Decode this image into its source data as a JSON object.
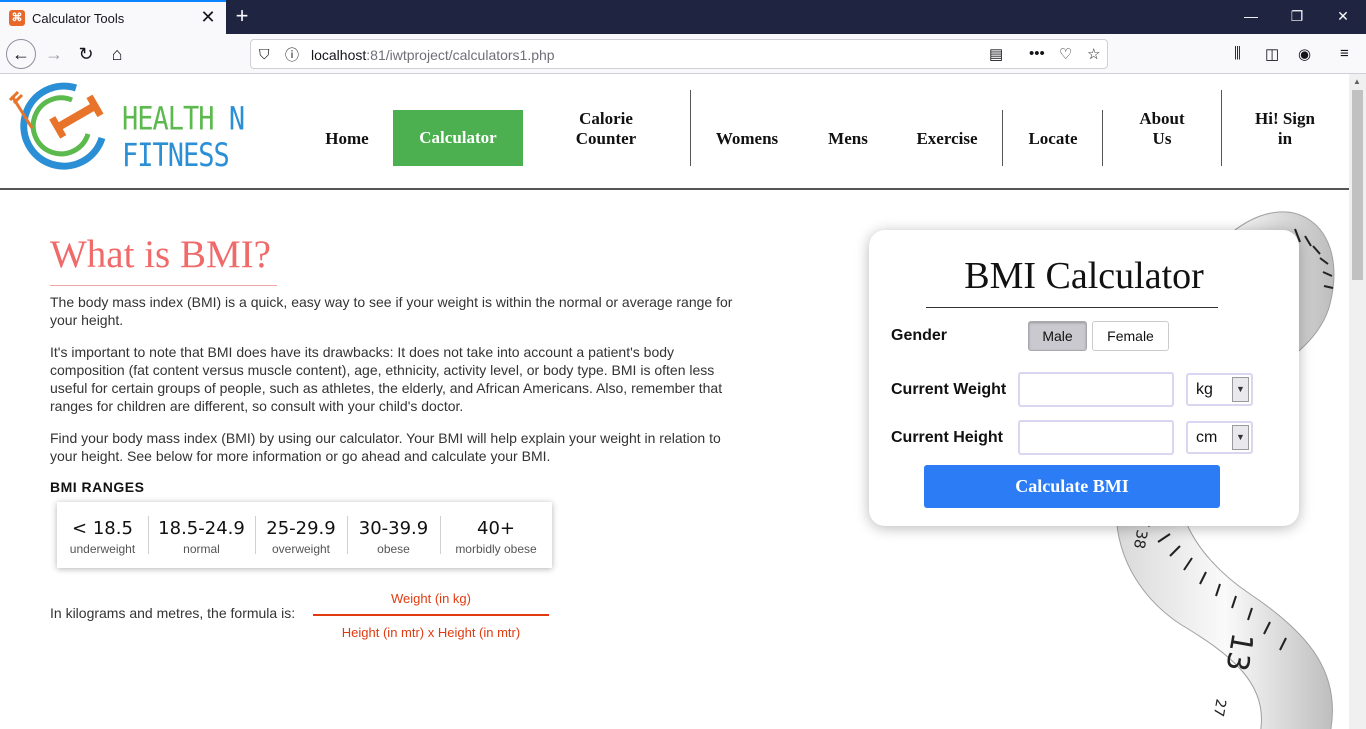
{
  "browser": {
    "tab_title": "Calculator Tools",
    "url_host": "localhost",
    "url_port": ":81",
    "url_path": "/iwtproject/calculators1.php"
  },
  "site": {
    "logo": {
      "word1": "HEALTH",
      "word2": "N",
      "word3": "FITNESS",
      "green": "#5bb94d",
      "blue": "#2b8fd6"
    },
    "menu": {
      "home": "Home",
      "calculator": "Calculator",
      "calorie_1": "Calorie",
      "calorie_2": "Counter",
      "womens": "Womens",
      "mens": "Mens",
      "exercise": "Exercise",
      "locate": "Locate",
      "about_1": "About",
      "about_2": "Us",
      "signin_1": "Hi! Sign",
      "signin_2": "in"
    },
    "active_color": "#4cb050"
  },
  "content": {
    "title": "What is BMI?",
    "p1": "The body mass index (BMI) is a quick, easy way to see if your weight is within the normal or average range for your height.",
    "p2": "It's important to note that BMI does have its drawbacks: It does not take into account a patient's body composition (fat content versus muscle content), age, ethnicity, activity level, or body type. BMI is often less useful for certain groups of people, such as athletes, the elderly, and African Americans. Also, remember that ranges for children are different, so consult with your child's doctor.",
    "p3": "Find your body mass index (BMI) by using our calculator. Your BMI will help explain your weight in relation to your height. See below for more information or go ahead and calculate your BMI.",
    "ranges_heading": "BMI RANGES",
    "ranges": [
      {
        "value": "< 18.5",
        "label": "underweight"
      },
      {
        "value": "18.5-24.9",
        "label": "normal"
      },
      {
        "value": "25-29.9",
        "label": "overweight"
      },
      {
        "value": "30-39.9",
        "label": "obese"
      },
      {
        "value": "40+",
        "label": "morbidly obese"
      }
    ],
    "formula_lead": "In kilograms and metres, the formula is:",
    "formula_numerator": "Weight (in kg)",
    "formula_denominator": "Height (in mtr) x Height (in mtr)"
  },
  "calculator": {
    "title": "BMI Calculator",
    "gender_label": "Gender",
    "male": "Male",
    "female": "Female",
    "weight_label": "Current Weight",
    "weight_value": "",
    "weight_unit": "kg",
    "height_label": "Current Height",
    "height_value": "",
    "height_unit": "cm",
    "button": "Calculate BMI",
    "button_color": "#2b7cf5"
  },
  "tape_numbers": {
    "n1": "38",
    "n2": "13",
    "n3": "27"
  }
}
